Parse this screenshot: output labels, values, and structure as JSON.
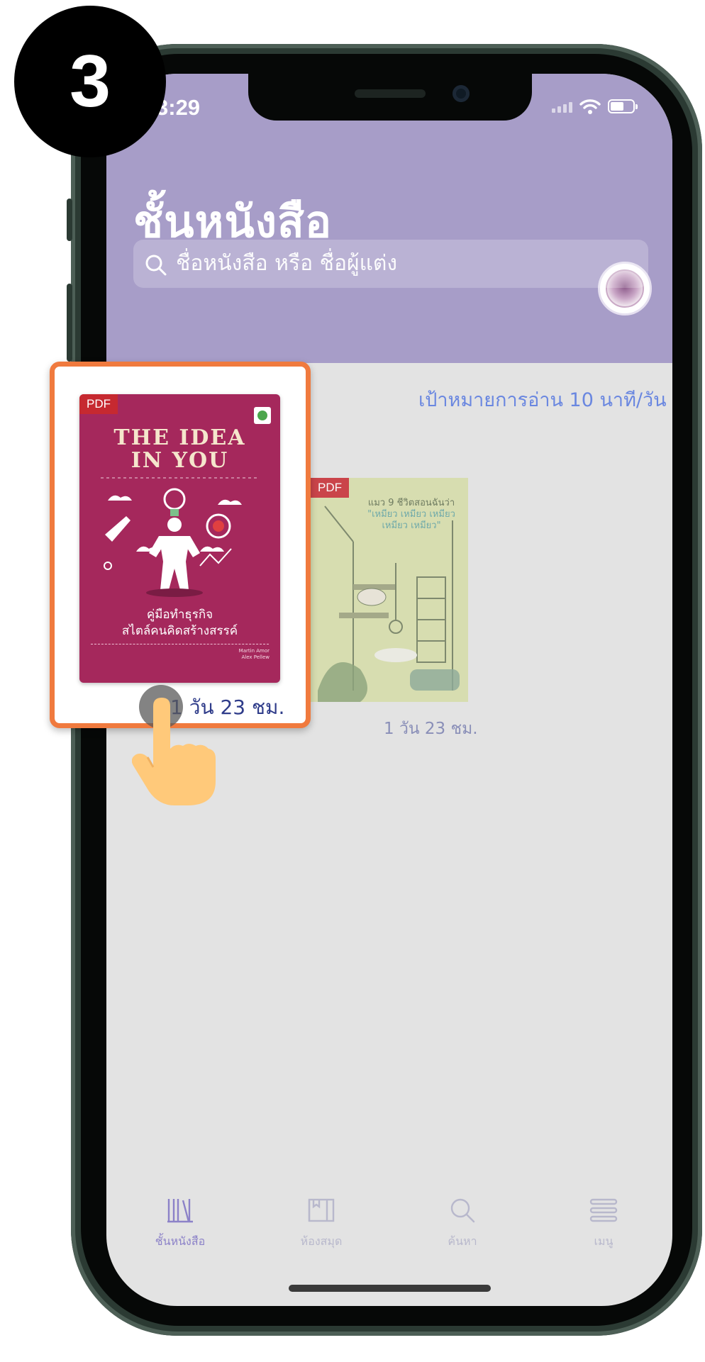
{
  "step": {
    "number": "3"
  },
  "status_bar": {
    "time": "3:29"
  },
  "header": {
    "title": "ชั้นหนังสือ",
    "search_placeholder": "ชื่อหนังสือ หรือ ชื่อผู้แต่ง"
  },
  "reading_goal": "เป้าหมายการอ่าน 10 นาที/วัน",
  "books": [
    {
      "badge": "PDF",
      "cover_title_line1": "THE IDEA",
      "cover_title_line2": "IN YOU",
      "cover_subtitle_line1": "คู่มือทำธุรกิจ",
      "cover_subtitle_line2": "สไตล์คนคิดสร้างสรรค์",
      "cover_authors_line1": "Martin Amor",
      "cover_authors_line2": "Alex Pellew",
      "due": "1 วัน 23 ชม."
    },
    {
      "badge": "PDF",
      "cover_title_line1": "แมว 9 ชีวิตสอนฉันว่า",
      "cover_title_line2": "\"เหมียว เหมียว เหมียว",
      "cover_title_line3": "เหมียว เหมียว\"",
      "due": "1 วัน 23 ชม."
    }
  ],
  "tab_bar": {
    "items": [
      {
        "label": "ชั้นหนังสือ",
        "icon": "bookshelf-icon",
        "active": true
      },
      {
        "label": "ห้องสมุด",
        "icon": "library-book-icon",
        "active": false
      },
      {
        "label": "ค้นหา",
        "icon": "search-icon",
        "active": false
      },
      {
        "label": "เมนู",
        "icon": "menu-icon",
        "active": false
      }
    ]
  },
  "colors": {
    "header": "#a79dc8",
    "accent_highlight": "#f07a3e",
    "goal_text": "#6a87e0",
    "tab_active": "#8c82c8",
    "tab_inactive": "#b8b8cc"
  }
}
